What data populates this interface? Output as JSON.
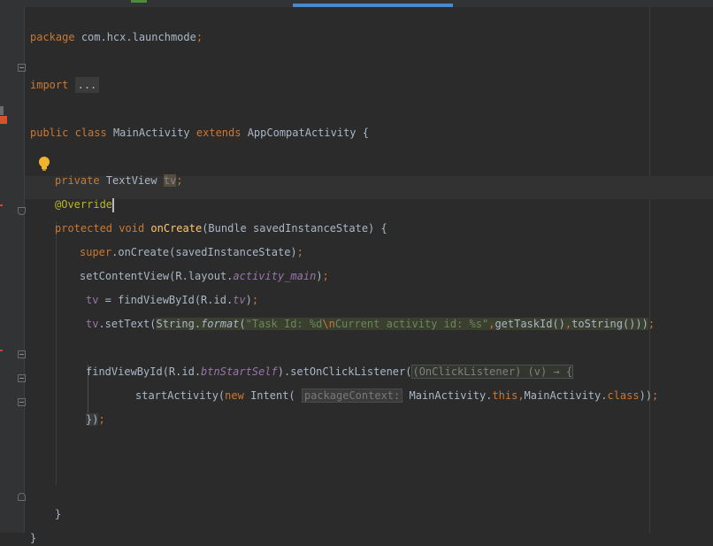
{
  "code": {
    "l1": {
      "kw": "package",
      "pkg": "com.hcx.launchmode",
      "semi": ";"
    },
    "l2": {
      "kw": "import",
      "folded": "..."
    },
    "l3": {
      "kw1": "public",
      "kw2": "class",
      "name": "MainActivity",
      "kw3": "extends",
      "parent": "AppCompatActivity",
      "brace": "{"
    },
    "l4": {
      "kw": "private",
      "type": "TextView",
      "field": "tv",
      "semi": ";"
    },
    "l5": {
      "ann": "@Override"
    },
    "l6": {
      "kw1": "protected",
      "kw2": "void",
      "method": "onCreate",
      "params": "(Bundle savedInstanceState)",
      "brace": "{"
    },
    "l7": {
      "kw": "super",
      "rest": ".onCreate(savedInstanceState)",
      "semi": ";"
    },
    "l8": {
      "call": "setContentView(R.layout.",
      "ref": "activity_main",
      "close": ")",
      "semi": ";"
    },
    "l9": {
      "field": "tv",
      "assign": " = findViewById(R.id.",
      "ref": "tv",
      "close": ")",
      "semi": ";"
    },
    "l10": {
      "field": "tv",
      "call": ".setText(",
      "cls": "String.",
      "fmt": "format",
      "open": "(",
      "str1": "\"Task Id: %d",
      "esc": "\\n",
      "str2": "Current activity id: %s\"",
      "comma1": ",",
      "args": "getTaskId()",
      "comma2": ",",
      "args2": "toString()",
      "close": "))",
      "semi": ";"
    },
    "l11": {
      "call": "findViewById(R.id.",
      "ref": "btnStartSelf",
      "rest": ").setOnClickListener(",
      "lambda": "(OnClickListener) (v) → {"
    },
    "l12": {
      "call": "startActivity(",
      "kw": "new",
      "cls": " Intent(",
      "hint": "packageContext:",
      "arg1": " MainActivity.",
      "kw2": "this",
      "comma": ",",
      "arg2": "MainActivity.",
      "kw3": "class",
      "close": "))",
      "semi": ";"
    },
    "l13": {
      "close": "})",
      "semi": ";"
    },
    "l14": {
      "brace": "}"
    },
    "l15": {
      "brace": "}"
    }
  }
}
